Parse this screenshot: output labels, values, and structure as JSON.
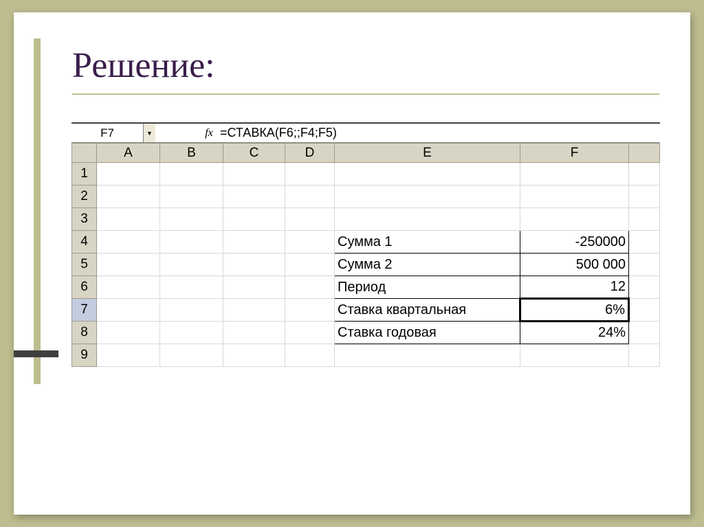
{
  "slide": {
    "title": "Решение:"
  },
  "formula_bar": {
    "name_box": "F7",
    "fx_label": "fx",
    "formula": "=СТАВКА(F6;;F4;F5)"
  },
  "columns": [
    "A",
    "B",
    "C",
    "D",
    "E",
    "F"
  ],
  "rows": [
    "1",
    "2",
    "3",
    "4",
    "5",
    "6",
    "7",
    "8",
    "9"
  ],
  "data": {
    "E4": "Сумма 1",
    "F4": "-250000",
    "E5": "Сумма 2",
    "F5": "500 000",
    "E6": "Период",
    "F6": "12",
    "E7": "Ставка квартальная",
    "F7": "6%",
    "E8": "Ставка годовая",
    "F8": "24%"
  }
}
